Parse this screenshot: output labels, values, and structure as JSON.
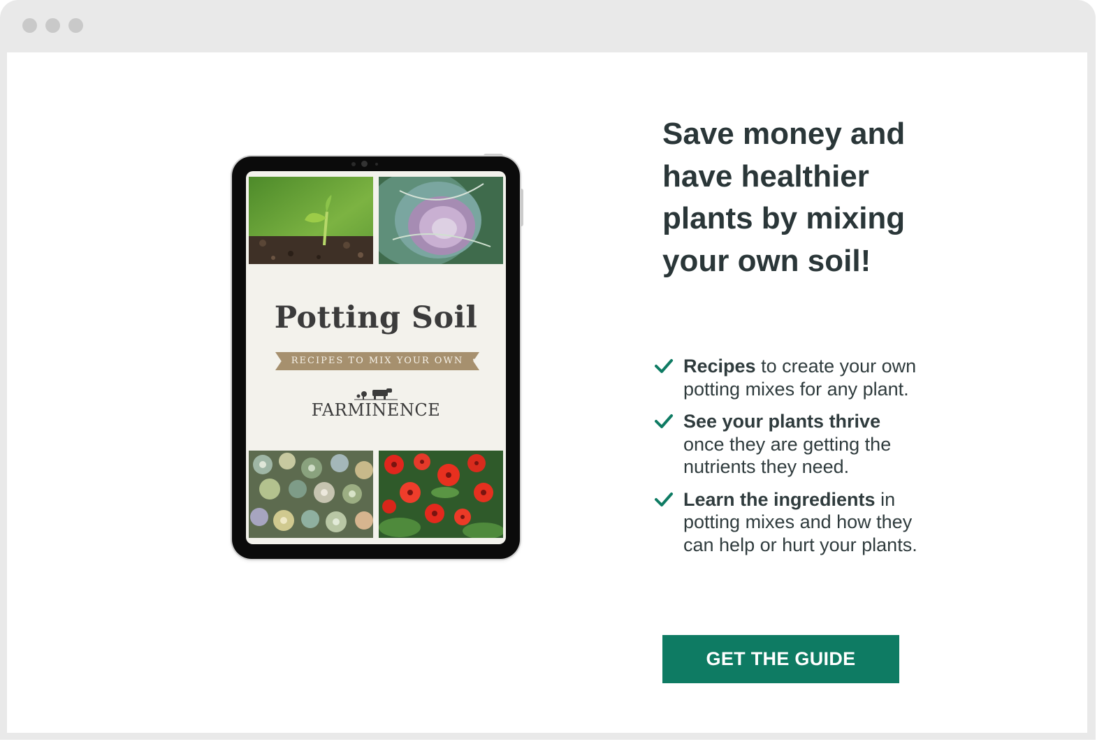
{
  "browser": {
    "controls": [
      "window-dot",
      "window-dot",
      "window-dot"
    ]
  },
  "ebook": {
    "title": "Potting Soil",
    "subtitle": "RECIPES TO MIX YOUR OWN",
    "brand": "FARMINENCE",
    "photos": [
      "seedling-photo",
      "cabbage-photo",
      "succulents-photo",
      "red-flowers-photo"
    ]
  },
  "headline": "Save money and have healthier plants by mixing your own soil!",
  "benefits": [
    {
      "strong": "Recipes",
      "text": " to create your own potting mixes for any plant."
    },
    {
      "strong": "See your plants thrive",
      "text": " once they are getting the nutrients they need."
    },
    {
      "strong": "Learn the ingredients",
      "text": " in potting mixes and how they can help or hurt your plants."
    }
  ],
  "cta": {
    "label": "GET THE GUIDE"
  },
  "colors": {
    "accent": "#0e7b63",
    "headline": "#2a3638",
    "ribbon": "#a6906e",
    "frame": "#e9e9e9"
  },
  "icons": [
    "check-icon",
    "farm-logo-icon"
  ]
}
